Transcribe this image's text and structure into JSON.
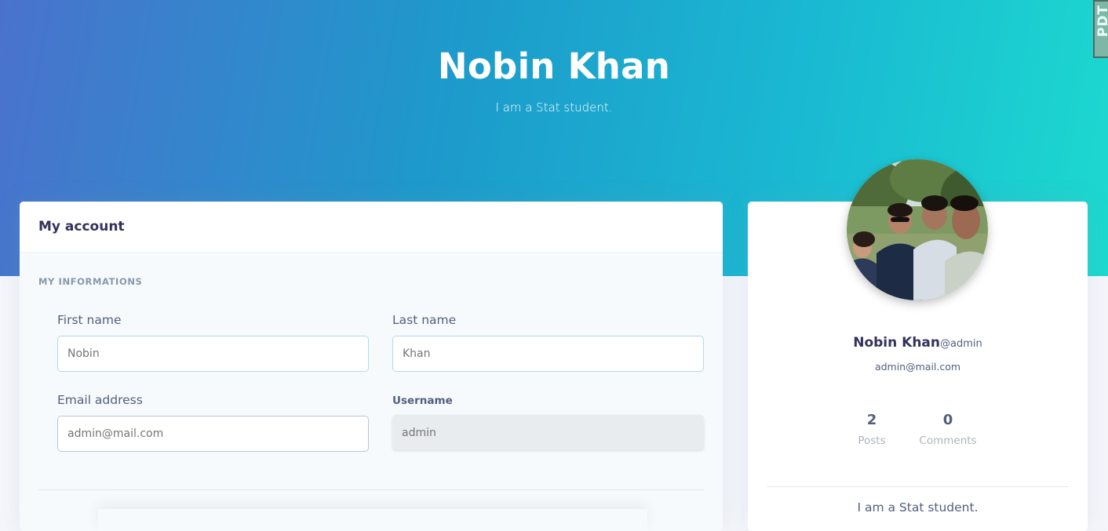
{
  "header": {
    "name": "Nobin Khan",
    "tagline": "I am a Stat student.",
    "corner_badge_text": "PDT"
  },
  "account": {
    "title": "My account",
    "section_label": "MY INFORMATIONS",
    "first_name": {
      "label": "First name",
      "value": "Nobin"
    },
    "last_name": {
      "label": "Last name",
      "value": "Khan"
    },
    "email": {
      "label": "Email address",
      "value": "admin@mail.com"
    },
    "username": {
      "label": "Username",
      "value": "admin"
    }
  },
  "profile": {
    "name": "Nobin Khan",
    "handle": "@admin",
    "email": "admin@mail.com",
    "stats": [
      {
        "value": "2",
        "label": "Posts"
      },
      {
        "value": "0",
        "label": "Comments"
      }
    ],
    "bio": "I am a Stat student."
  },
  "colors": {
    "gradient_start": "#4a72cd",
    "gradient_end": "#1cd9cf",
    "text_dark": "#32325d",
    "text_muted": "#8898aa"
  }
}
